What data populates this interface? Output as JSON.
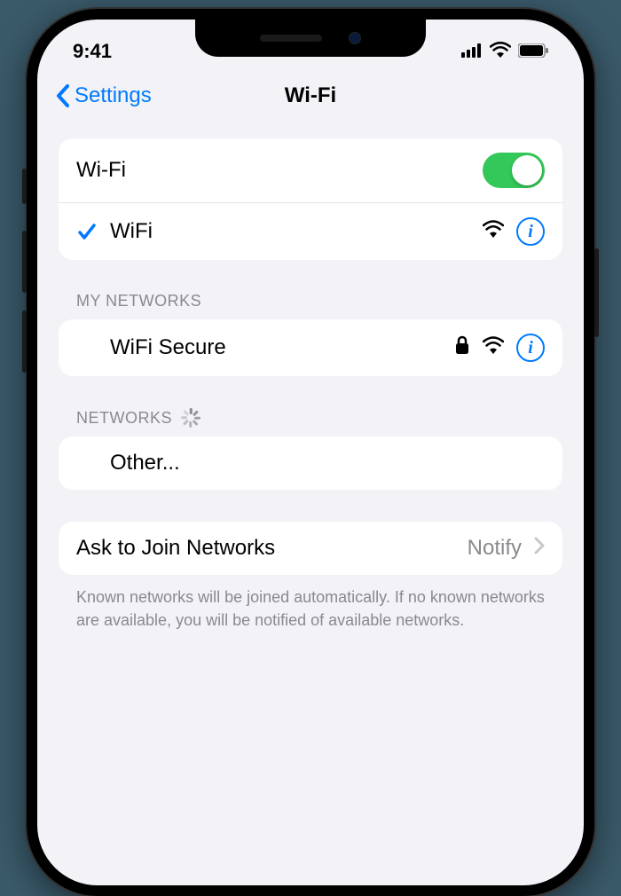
{
  "status": {
    "time": "9:41"
  },
  "nav": {
    "back_label": "Settings",
    "title": "Wi-Fi"
  },
  "wifi": {
    "toggle_label": "Wi-Fi",
    "toggle_on": true,
    "connected_network": "WiFi"
  },
  "my_networks": {
    "header": "MY NETWORKS",
    "items": [
      {
        "name": "WiFi Secure",
        "secured": true
      }
    ]
  },
  "networks": {
    "header": "NETWORKS",
    "other_label": "Other..."
  },
  "ask_join": {
    "label": "Ask to Join Networks",
    "value": "Notify",
    "footer": "Known networks will be joined automatically. If no known networks are available, you will be notified of available networks."
  }
}
